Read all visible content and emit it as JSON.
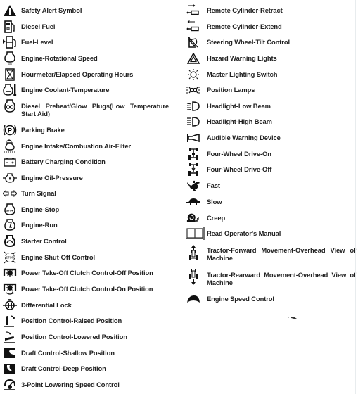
{
  "left_column": [
    {
      "label": "Safety Alert Symbol",
      "icon": "safety-alert-icon"
    },
    {
      "label": "Diesel Fuel",
      "icon": "diesel-fuel-icon"
    },
    {
      "label": "Fuel-Level",
      "icon": "fuel-level-icon"
    },
    {
      "label": "Engine-Rotational Speed",
      "icon": "engine-rpm-icon"
    },
    {
      "label": "Hourmeter/Elapsed Operating Hours",
      "icon": "hourglass-icon"
    },
    {
      "label": "Engine Coolant-Temperature",
      "icon": "coolant-temperature-icon"
    },
    {
      "label": "Diesel Preheat/Glow Plugs(Low Temperature Start Aid)",
      "icon": "glow-plug-icon"
    },
    {
      "label": "Parking Brake",
      "icon": "parking-brake-icon"
    },
    {
      "label": "Engine Intake/Combustion Air-Filter",
      "icon": "air-filter-icon"
    },
    {
      "label": "Battery Charging Condition",
      "icon": "battery-icon"
    },
    {
      "label": "Engine Oil-Pressure",
      "icon": "oil-pressure-icon"
    },
    {
      "label": "Turn Signal",
      "icon": "turn-signal-icon"
    },
    {
      "label": "Engine-Stop",
      "icon": "engine-stop-icon"
    },
    {
      "label": "Engine-Run",
      "icon": "engine-run-icon"
    },
    {
      "label": "Starter Control",
      "icon": "starter-icon"
    },
    {
      "label": "Engine Shut-Off Control",
      "icon": "engine-shutoff-icon"
    },
    {
      "label": "Power Take-Off Clutch Control-Off Position",
      "icon": "pto-off-icon"
    },
    {
      "label": "Power Take-Off Clutch Control-On Position",
      "icon": "pto-on-icon"
    },
    {
      "label": "Differential Lock",
      "icon": "differential-lock-icon"
    },
    {
      "label": "Position Control-Raised Position",
      "icon": "position-raised-icon"
    },
    {
      "label": "Position Control-Lowered Position",
      "icon": "position-lowered-icon"
    },
    {
      "label": "Draft Control-Shallow Position",
      "icon": "draft-shallow-icon"
    },
    {
      "label": "Draft Control-Deep Position",
      "icon": "draft-deep-icon"
    },
    {
      "label": "3-Point Lowering Speed Control",
      "icon": "lowering-speed-icon"
    }
  ],
  "right_column": [
    {
      "label": "Remote Cylinder-Retract",
      "icon": "cylinder-retract-icon"
    },
    {
      "label": "Remote Cylinder-Extend",
      "icon": "cylinder-extend-icon"
    },
    {
      "label": "Steering Wheel-Tilt Control",
      "icon": "steering-tilt-icon"
    },
    {
      "label": "Hazard Warning Lights",
      "icon": "hazard-icon"
    },
    {
      "label": "Master Lighting Switch",
      "icon": "master-light-icon"
    },
    {
      "label": "Position Lamps",
      "icon": "position-lamps-icon"
    },
    {
      "label": "Headlight-Low Beam",
      "icon": "low-beam-icon"
    },
    {
      "label": "Headlight-High Beam",
      "icon": "high-beam-icon"
    },
    {
      "label": "Audible Warning Device",
      "icon": "horn-icon"
    },
    {
      "label": "Four-Wheel Drive-On",
      "icon": "4wd-on-icon"
    },
    {
      "label": "Four-Wheel Drive-Off",
      "icon": "4wd-off-icon"
    },
    {
      "label": "Fast",
      "icon": "rabbit-icon"
    },
    {
      "label": "Slow",
      "icon": "turtle-icon"
    },
    {
      "label": "Creep",
      "icon": "snail-icon"
    },
    {
      "label": "Read Operator's Manual",
      "icon": "manual-book-icon"
    },
    {
      "label": "Tractor-Forward Movement-Overhead View of Machine",
      "icon": "tractor-forward-icon"
    },
    {
      "label": "Tractor-Rearward Movement-Overhead View of Machine",
      "icon": "tractor-rearward-icon"
    },
    {
      "label": "Engine Speed Control",
      "icon": "engine-speed-control-icon"
    }
  ]
}
